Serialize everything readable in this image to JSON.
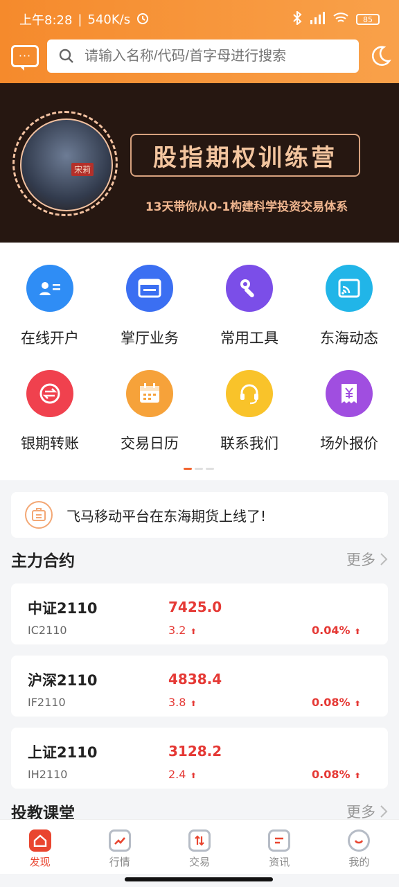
{
  "status_bar": {
    "time": "上午8:28",
    "speed": "540K/s",
    "battery": "85"
  },
  "header": {
    "search_placeholder": "请输入名称/代码/首字母进行搜索"
  },
  "banner": {
    "presenter": "宋莉",
    "title": "股指期权训练营",
    "subtitle": "13天带你从0-1构建科学投资交易体系"
  },
  "quick_menu": {
    "row1": [
      {
        "label": "在线开户",
        "icon": "id-card-icon",
        "color": "#2f8df5"
      },
      {
        "label": "掌厅业务",
        "icon": "window-icon",
        "color": "#3b6ff2"
      },
      {
        "label": "常用工具",
        "icon": "wrench-icon",
        "color": "#7b4ee8"
      },
      {
        "label": "东海动态",
        "icon": "cast-icon",
        "color": "#21b5e8"
      }
    ],
    "row2": [
      {
        "label": "银期转账",
        "icon": "exchange-icon",
        "color": "#f0414e"
      },
      {
        "label": "交易日历",
        "icon": "calendar-icon",
        "color": "#f6a23a"
      },
      {
        "label": "联系我们",
        "icon": "headset-icon",
        "color": "#f9c32a"
      },
      {
        "label": "场外报价",
        "icon": "yuan-receipt-icon",
        "color": "#a04ee0"
      }
    ]
  },
  "notice": {
    "text": "飞马移动平台在东海期货上线了!"
  },
  "contracts": {
    "title": "主力合约",
    "more": "更多",
    "items": [
      {
        "name": "中证2110",
        "code": "IC2110",
        "price": "7425.0",
        "change": "3.2",
        "percent": "0.04%"
      },
      {
        "name": "沪深2110",
        "code": "IF2110",
        "price": "4838.4",
        "change": "3.8",
        "percent": "0.08%"
      },
      {
        "name": "上证2110",
        "code": "IH2110",
        "price": "3128.2",
        "change": "2.4",
        "percent": "0.08%"
      }
    ]
  },
  "education": {
    "title": "投教课堂",
    "more": "更多"
  },
  "tabbar": {
    "items": [
      {
        "label": "发现",
        "icon": "home-icon"
      },
      {
        "label": "行情",
        "icon": "trend-icon"
      },
      {
        "label": "交易",
        "icon": "trade-icon"
      },
      {
        "label": "资讯",
        "icon": "news-icon"
      },
      {
        "label": "我的",
        "icon": "profile-icon"
      }
    ]
  }
}
